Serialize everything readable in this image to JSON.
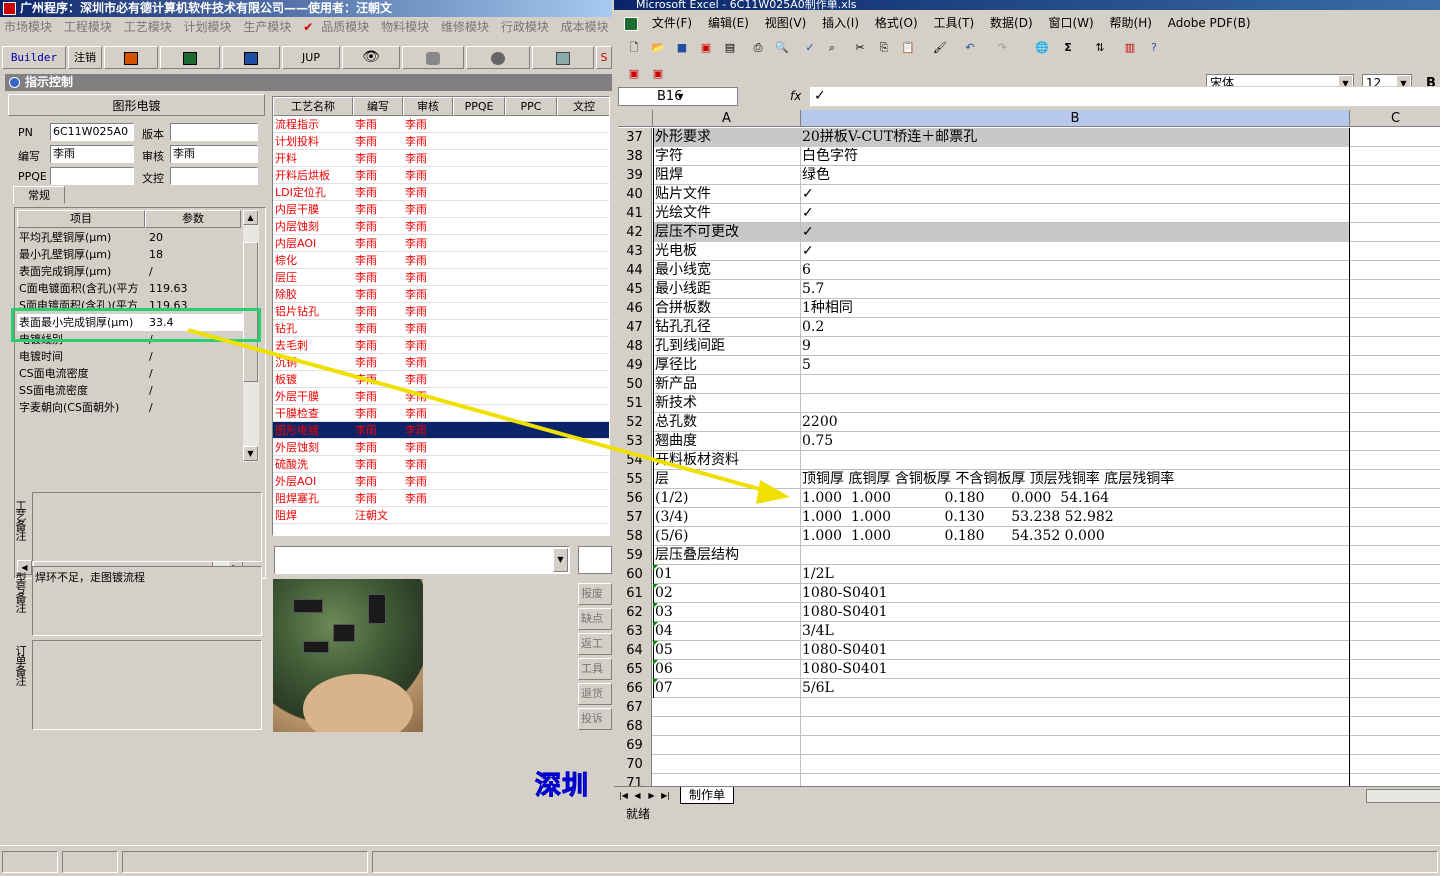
{
  "left_app": {
    "title": "广州程序：深圳市必有德计算机软件技术有限公司——使用者：汪朝文",
    "menu": [
      "市场模块",
      "工程模块",
      "工艺模块",
      "计划模块",
      "生产模块",
      "品质模块",
      "物料模块",
      "维修模块",
      "行政模块",
      "成本模块"
    ],
    "toolbar": {
      "builder": "Builder",
      "logout": "注销",
      "jup": "JUP",
      "s": "S"
    },
    "panel_title": "指示控制",
    "process_name": "图形电镀",
    "fields": {
      "pn_label": "PN",
      "pn_value": "6C11W025A0",
      "version_label": "版本",
      "version_value": "",
      "author_label": "编写",
      "author_value": "李雨",
      "review_label": "审核",
      "review_value": "李雨",
      "ppqe_label": "PPQE",
      "ppqe_value": "",
      "docno_label": "文控",
      "docno_value": ""
    },
    "tab_general": "常规",
    "param_headers": [
      "项目",
      "参数"
    ],
    "params": [
      {
        "k": "平均孔壁铜厚(μm)",
        "v": "20"
      },
      {
        "k": "最小孔壁铜厚(μm)",
        "v": "18"
      },
      {
        "k": "表面完成铜厚(μm)",
        "v": "/"
      },
      {
        "k": "C面电镀面积(含孔)(平方",
        "v": "119.63"
      },
      {
        "k": "S面电镀面积(含孔)(平方",
        "v": "119.63"
      },
      {
        "k": "表面最小完成铜厚(μm)",
        "v": "33.4"
      },
      {
        "k": "电镀线别",
        "v": "/"
      },
      {
        "k": "电镀时间",
        "v": "/"
      },
      {
        "k": "CS面电流密度",
        "v": "/"
      },
      {
        "k": "SS面电流密度",
        "v": "/"
      },
      {
        "k": "字麦朝向(CS面朝外)",
        "v": "/"
      }
    ],
    "notes": {
      "process_note_label": "工艺备注",
      "process_note": "",
      "model_note_label": "型号备注",
      "model_note": "焊环不足，走图镀流程",
      "order_note_label": "订单备注",
      "order_note": ""
    },
    "process_headers": [
      "工艺名称",
      "编写",
      "审核",
      "PPQE",
      "PPC",
      "文控"
    ],
    "processes": [
      {
        "name": "流程指示",
        "author": "李雨",
        "review": "李雨"
      },
      {
        "name": "计划投料",
        "author": "李雨",
        "review": "李雨"
      },
      {
        "name": "开料",
        "author": "李雨",
        "review": "李雨"
      },
      {
        "name": "开料后烘板",
        "author": "李雨",
        "review": "李雨"
      },
      {
        "name": "LDI定位孔",
        "author": "李雨",
        "review": "李雨"
      },
      {
        "name": "内层干膜",
        "author": "李雨",
        "review": "李雨"
      },
      {
        "name": "内层蚀刻",
        "author": "李雨",
        "review": "李雨"
      },
      {
        "name": "内层AOI",
        "author": "李雨",
        "review": "李雨"
      },
      {
        "name": "棕化",
        "author": "李雨",
        "review": "李雨"
      },
      {
        "name": "层压",
        "author": "李雨",
        "review": "李雨"
      },
      {
        "name": "除胶",
        "author": "李雨",
        "review": "李雨"
      },
      {
        "name": "铝片钻孔",
        "author": "李雨",
        "review": "李雨"
      },
      {
        "name": "钻孔",
        "author": "李雨",
        "review": "李雨"
      },
      {
        "name": "去毛刺",
        "author": "李雨",
        "review": "李雨"
      },
      {
        "name": "沉铜",
        "author": "李雨",
        "review": "李雨"
      },
      {
        "name": "板镀",
        "author": "李雨",
        "review": "李雨"
      },
      {
        "name": "外层干膜",
        "author": "李雨",
        "review": "李雨"
      },
      {
        "name": "干膜检查",
        "author": "李雨",
        "review": "李雨"
      },
      {
        "name": "图形电镀",
        "author": "李雨",
        "review": "李雨",
        "selected": true
      },
      {
        "name": "外层蚀刻",
        "author": "李雨",
        "review": "李雨"
      },
      {
        "name": "硫酸洗",
        "author": "李雨",
        "review": "李雨"
      },
      {
        "name": "外层AOI",
        "author": "李雨",
        "review": "李雨"
      },
      {
        "name": "阻焊塞孔",
        "author": "李雨",
        "review": "李雨"
      },
      {
        "name": "阻焊",
        "author": "汪朝文",
        "review": ""
      }
    ],
    "side_buttons": [
      "报废",
      "缺点",
      "返工",
      "工具",
      "退货",
      "投诉"
    ],
    "desktop_logo": "深圳"
  },
  "excel": {
    "title": "Microsoft Excel - 6C11W025A0制作单.xls",
    "menu": [
      "文件(F)",
      "编辑(E)",
      "视图(V)",
      "插入(I)",
      "格式(O)",
      "工具(T)",
      "数据(D)",
      "窗口(W)",
      "帮助(H)",
      "Adobe PDF(B)"
    ],
    "font": "宋体",
    "size": "12",
    "cell_ref": "B16",
    "formula": "✓",
    "columns": [
      "A",
      "B",
      "C"
    ],
    "rows": [
      {
        "n": "37",
        "a": "外形要求",
        "b": "20拼板V-CUT桥连＋邮票孔",
        "hl": true
      },
      {
        "n": "38",
        "a": "字符",
        "b": "白色字符"
      },
      {
        "n": "39",
        "a": "阻焊",
        "b": "绿色"
      },
      {
        "n": "40",
        "a": "贴片文件",
        "b": "✓"
      },
      {
        "n": "41",
        "a": "光绘文件",
        "b": "✓"
      },
      {
        "n": "42",
        "a": "层压不可更改",
        "b": "✓",
        "hl": true
      },
      {
        "n": "43",
        "a": "光电板",
        "b": "✓"
      },
      {
        "n": "44",
        "a": "最小线宽",
        "b": "6"
      },
      {
        "n": "45",
        "a": "最小线距",
        "b": "5.7"
      },
      {
        "n": "46",
        "a": "合拼板数",
        "b": "1种相同"
      },
      {
        "n": "47",
        "a": "钻孔孔径",
        "b": "0.2"
      },
      {
        "n": "48",
        "a": "孔到线间距",
        "b": "9"
      },
      {
        "n": "49",
        "a": "厚径比",
        "b": "5"
      },
      {
        "n": "50",
        "a": "新产品",
        "b": ""
      },
      {
        "n": "51",
        "a": "新技术",
        "b": ""
      },
      {
        "n": "52",
        "a": "总孔数",
        "b": "2200"
      },
      {
        "n": "53",
        "a": "翘曲度",
        "b": "0.75"
      },
      {
        "n": "54",
        "a": "开料板材资料",
        "b": ""
      },
      {
        "n": "55",
        "a": "层",
        "b": "顶铜厚 底铜厚 含铜板厚 不含铜板厚 顶层残铜率 底层残铜率"
      },
      {
        "n": "56",
        "a": "(1/2)",
        "b": "1.000  1.000            0.180      0.000  54.164"
      },
      {
        "n": "57",
        "a": "(3/4)",
        "b": "1.000  1.000            0.130      53.238 52.982"
      },
      {
        "n": "58",
        "a": "(5/6)",
        "b": "1.000  1.000            0.180      54.352 0.000"
      },
      {
        "n": "59",
        "a": "层压叠层结构",
        "b": ""
      },
      {
        "n": "60",
        "a": "01",
        "b": "1/2L"
      },
      {
        "n": "61",
        "a": "02",
        "b": "1080-S0401"
      },
      {
        "n": "62",
        "a": "03",
        "b": "1080-S0401"
      },
      {
        "n": "63",
        "a": "04",
        "b": "3/4L"
      },
      {
        "n": "64",
        "a": "05",
        "b": "1080-S0401"
      },
      {
        "n": "65",
        "a": "06",
        "b": "1080-S0401"
      },
      {
        "n": "66",
        "a": "07",
        "b": "5/6L"
      },
      {
        "n": "67",
        "a": "",
        "b": ""
      },
      {
        "n": "68",
        "a": "",
        "b": ""
      },
      {
        "n": "69",
        "a": "",
        "b": ""
      },
      {
        "n": "70",
        "a": "",
        "b": ""
      },
      {
        "n": "71",
        "a": "",
        "b": ""
      }
    ],
    "sheet_tab": "制作单",
    "status": "就绪"
  },
  "colors": {
    "highlight_box": "#2ecc71",
    "arrow": "#f0e000",
    "process_text": "#e00000",
    "selected_row": "#0a246a"
  }
}
